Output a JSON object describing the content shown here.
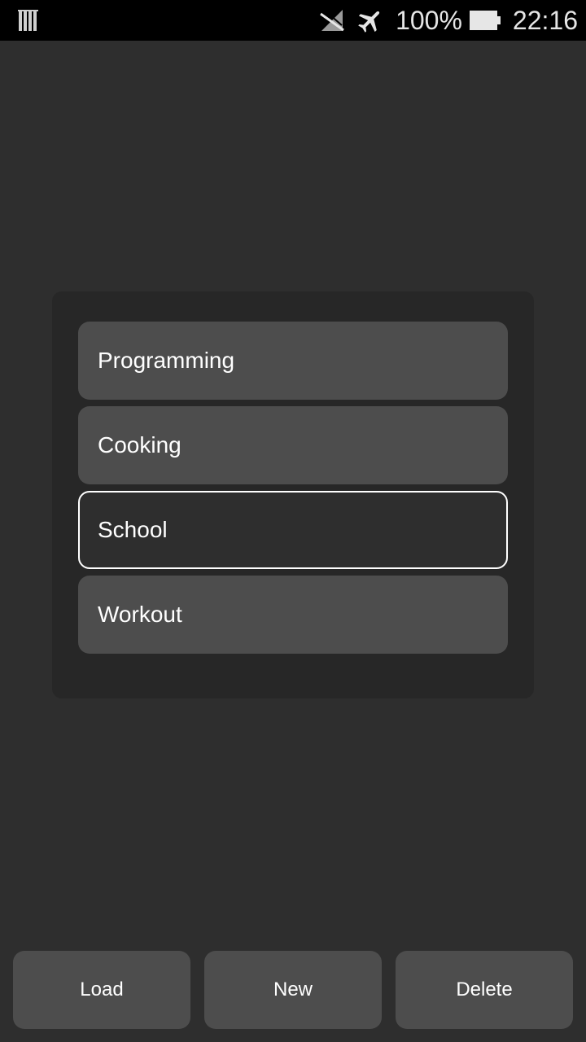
{
  "status_bar": {
    "left_icon": "barcode-notification-icon",
    "icons": [
      "signal-off-icon",
      "airplane-mode-icon",
      "battery-icon"
    ],
    "battery_percent": "100%",
    "time": "22:16"
  },
  "list": {
    "items": [
      {
        "label": "Programming",
        "selected": false
      },
      {
        "label": "Cooking",
        "selected": false
      },
      {
        "label": "School",
        "selected": true
      },
      {
        "label": "Workout",
        "selected": false
      }
    ]
  },
  "actions": {
    "load_label": "Load",
    "new_label": "New",
    "delete_label": "Delete"
  },
  "colors": {
    "background": "#2e2e2e",
    "panel": "#272727",
    "item": "#4d4d4d",
    "selected_border": "#ffffff",
    "status_bar": "#000000"
  }
}
